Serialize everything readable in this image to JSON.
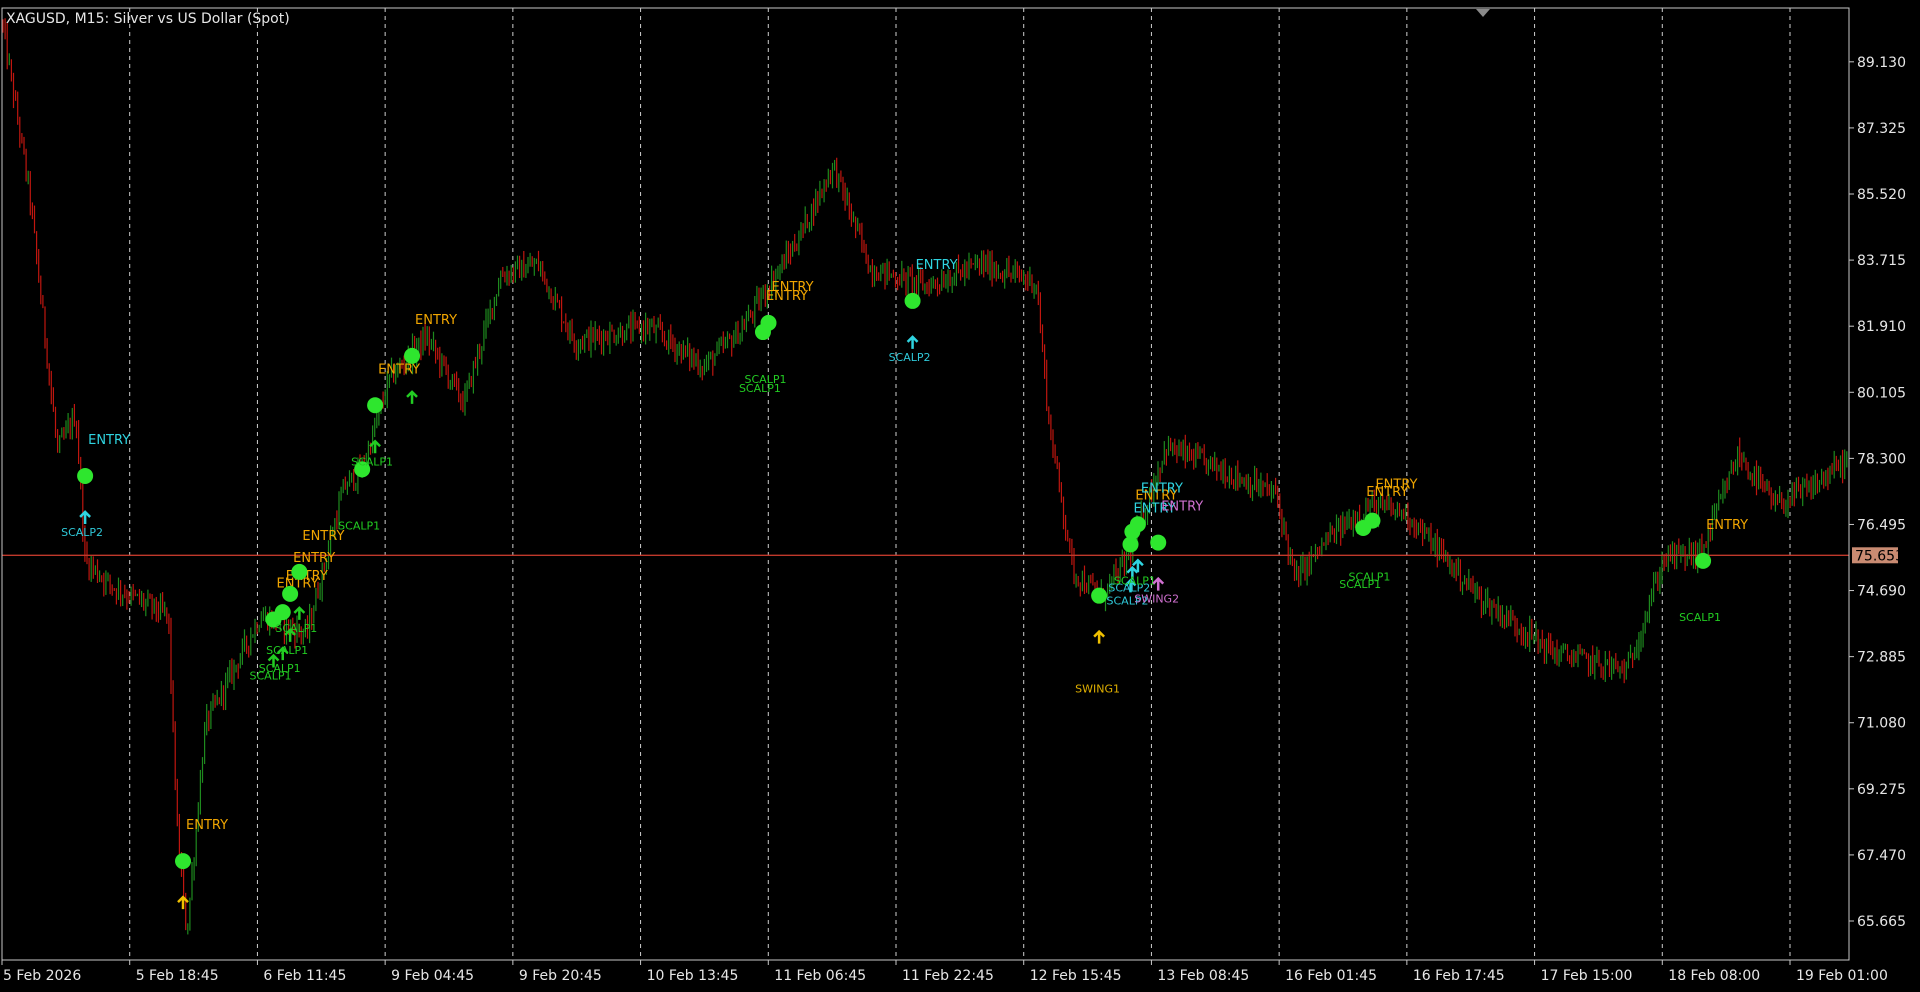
{
  "header": {
    "symbol_title": "XAGUSD, M15:  Silver vs US Dollar (Spot)"
  },
  "colors": {
    "background": "#000000",
    "axis": "#c8c8c8",
    "vgrid": "#cfcfcf",
    "bull_candle": "#1e8a1e",
    "bear_candle": "#c0160f",
    "price_line": "#c0392b",
    "price_badge": "#c98b72",
    "dot": "#2ee62e",
    "entry_orange": "#f0a500",
    "entry_cyan": "#2fd4e0",
    "scalp_green": "#22cc22",
    "scalp_cyan": "#2fc8d8",
    "swing_yellow": "#e0b000",
    "swing_violet": "#d070d0"
  },
  "chart_data": {
    "type": "candlestick",
    "title": "XAGUSD, M15:  Silver vs US Dollar (Spot)",
    "grid": "vertical dashed",
    "ylim": [
      64.6,
      90.6
    ],
    "y_ticks": [
      "89.130",
      "87.325",
      "85.520",
      "83.715",
      "81.910",
      "80.105",
      "78.300",
      "76.495",
      "74.690",
      "72.885",
      "71.080",
      "69.275",
      "67.470",
      "65.665"
    ],
    "x_ticks": [
      "5 Feb 2026",
      "5 Feb 18:45",
      "6 Feb 11:45",
      "9 Feb 04:45",
      "9 Feb 20:45",
      "10 Feb 13:45",
      "11 Feb 06:45",
      "11 Feb 22:45",
      "12 Feb 15:45",
      "13 Feb 08:45",
      "16 Feb 01:45",
      "16 Feb 17:45",
      "17 Feb 15:00",
      "18 Feb 08:00",
      "19 Feb 01:00"
    ],
    "current_price": "75.653",
    "price_path": [
      [
        0,
        90.2
      ],
      [
        0.015,
        85.5
      ],
      [
        0.03,
        78.5
      ],
      [
        0.04,
        79.5
      ],
      [
        0.045,
        75.5
      ],
      [
        0.06,
        74.8
      ],
      [
        0.09,
        74.0
      ],
      [
        0.095,
        68.0
      ],
      [
        0.1,
        65.3
      ],
      [
        0.11,
        71.0
      ],
      [
        0.14,
        74.0
      ],
      [
        0.165,
        73.5
      ],
      [
        0.185,
        77.5
      ],
      [
        0.195,
        78.0
      ],
      [
        0.21,
        80.5
      ],
      [
        0.23,
        81.6
      ],
      [
        0.25,
        79.8
      ],
      [
        0.27,
        83.3
      ],
      [
        0.29,
        83.6
      ],
      [
        0.31,
        81.5
      ],
      [
        0.35,
        81.9
      ],
      [
        0.38,
        80.8
      ],
      [
        0.4,
        81.8
      ],
      [
        0.43,
        84.2
      ],
      [
        0.45,
        86.3
      ],
      [
        0.47,
        83.5
      ],
      [
        0.5,
        83.0
      ],
      [
        0.53,
        83.6
      ],
      [
        0.56,
        83.1
      ],
      [
        0.567,
        79.2
      ],
      [
        0.58,
        75.2
      ],
      [
        0.595,
        74.5
      ],
      [
        0.61,
        75.6
      ],
      [
        0.63,
        78.6
      ],
      [
        0.66,
        78.0
      ],
      [
        0.69,
        77.3
      ],
      [
        0.7,
        75.0
      ],
      [
        0.72,
        76.2
      ],
      [
        0.74,
        77.0
      ],
      [
        0.76,
        76.8
      ],
      [
        0.8,
        74.5
      ],
      [
        0.84,
        73.0
      ],
      [
        0.88,
        72.5
      ],
      [
        0.9,
        75.6
      ],
      [
        0.92,
        75.7
      ],
      [
        0.94,
        78.4
      ],
      [
        0.96,
        77.0
      ],
      [
        0.98,
        77.5
      ],
      [
        1.0,
        78.3
      ]
    ],
    "signals": [
      {
        "entry": "ENTRY",
        "scalp": "SCALP2",
        "entry_color": "#2fd4e0",
        "scalp_color": "#2fc8d8",
        "arrow_color": "#2fd4e0",
        "price": 77.82,
        "bar": 0.045
      },
      {
        "entry": "ENTRY",
        "scalp": "",
        "entry_color": "#f0a500",
        "scalp_color": "",
        "arrow_color": "#f0c000",
        "price": 67.3,
        "bar": 0.098
      },
      {
        "entry": "ENTRY",
        "scalp": "SCALP1",
        "entry_color": "#f0a500",
        "scalp_color": "#22cc22",
        "arrow_color": "#22cc22",
        "price": 73.9,
        "bar": 0.147
      },
      {
        "entry": "ENTRY",
        "scalp": "SCALP1",
        "entry_color": "#f0a500",
        "scalp_color": "#22cc22",
        "arrow_color": "#22cc22",
        "price": 74.1,
        "bar": 0.152
      },
      {
        "entry": "ENTRY",
        "scalp": "SCALP1",
        "entry_color": "#f0a500",
        "scalp_color": "#22cc22",
        "arrow_color": "#22cc22",
        "price": 74.6,
        "bar": 0.156
      },
      {
        "entry": "ENTRY",
        "scalp": "SCALP1",
        "entry_color": "#f0a500",
        "scalp_color": "#22cc22",
        "arrow_color": "#22cc22",
        "price": 75.2,
        "bar": 0.161
      },
      {
        "entry": "",
        "scalp": "SCALP1",
        "entry_color": "",
        "scalp_color": "#22cc22",
        "arrow_color": "",
        "price": 78.0,
        "bar": 0.195
      },
      {
        "entry": "ENTRY",
        "scalp": "SCALP1",
        "entry_color": "#f0a500",
        "scalp_color": "#22cc22",
        "arrow_color": "#22cc22",
        "price": 79.75,
        "bar": 0.202
      },
      {
        "entry": "ENTRY",
        "scalp": "",
        "entry_color": "#f0a500",
        "scalp_color": "",
        "arrow_color": "#22cc22",
        "price": 81.1,
        "bar": 0.222
      },
      {
        "entry": "ENTRY",
        "scalp": "SCALP1",
        "entry_color": "#f0a500",
        "scalp_color": "#22cc22",
        "arrow_color": "",
        "price": 81.75,
        "bar": 0.412
      },
      {
        "entry": "ENTRY",
        "scalp": "SCALP1",
        "entry_color": "#f0a500",
        "scalp_color": "#22cc22",
        "arrow_color": "",
        "price": 82.0,
        "bar": 0.415
      },
      {
        "entry": "ENTRY",
        "scalp": "SCALP2",
        "entry_color": "#2fd4e0",
        "scalp_color": "#2fc8d8",
        "arrow_color": "#2fd4e0",
        "price": 82.6,
        "bar": 0.493
      },
      {
        "entry": "",
        "scalp": "SWING1",
        "entry_color": "",
        "scalp_color": "#e0b000",
        "arrow_color": "#f0c000",
        "price": 74.55,
        "bar": 0.594
      },
      {
        "entry": "ENTRY",
        "scalp": "SCALP2",
        "entry_color": "#2fd4e0",
        "scalp_color": "#2fc8d8",
        "arrow_color": "#2fd4e0",
        "price": 75.95,
        "bar": 0.611
      },
      {
        "entry": "ENTRY",
        "scalp": "SCALP2",
        "entry_color": "#f0a500",
        "scalp_color": "#2fc8d8",
        "arrow_color": "#2fd4e0",
        "price": 76.3,
        "bar": 0.612
      },
      {
        "entry": "ENTRY",
        "scalp": "SCALP1",
        "entry_color": "#2fd4e0",
        "scalp_color": "#22cc22",
        "arrow_color": "#2fd4e0",
        "price": 76.5,
        "bar": 0.615
      },
      {
        "entry": "ENTRY",
        "scalp": "SWING2",
        "entry_color": "#d070d0",
        "scalp_color": "#d070d0",
        "arrow_color": "#d070d0",
        "price": 76.0,
        "bar": 0.626
      },
      {
        "entry": "ENTRY",
        "scalp": "SCALP1",
        "entry_color": "#f0a500",
        "scalp_color": "#22cc22",
        "arrow_color": "",
        "price": 76.4,
        "bar": 0.737
      },
      {
        "entry": "ENTRY",
        "scalp": "SCALP1",
        "entry_color": "#f0a500",
        "scalp_color": "#22cc22",
        "arrow_color": "",
        "price": 76.6,
        "bar": 0.742
      },
      {
        "entry": "ENTRY",
        "scalp": "SCALP1",
        "entry_color": "#f0a500",
        "scalp_color": "#22cc22",
        "arrow_color": "",
        "price": 75.5,
        "bar": 0.921
      }
    ]
  }
}
